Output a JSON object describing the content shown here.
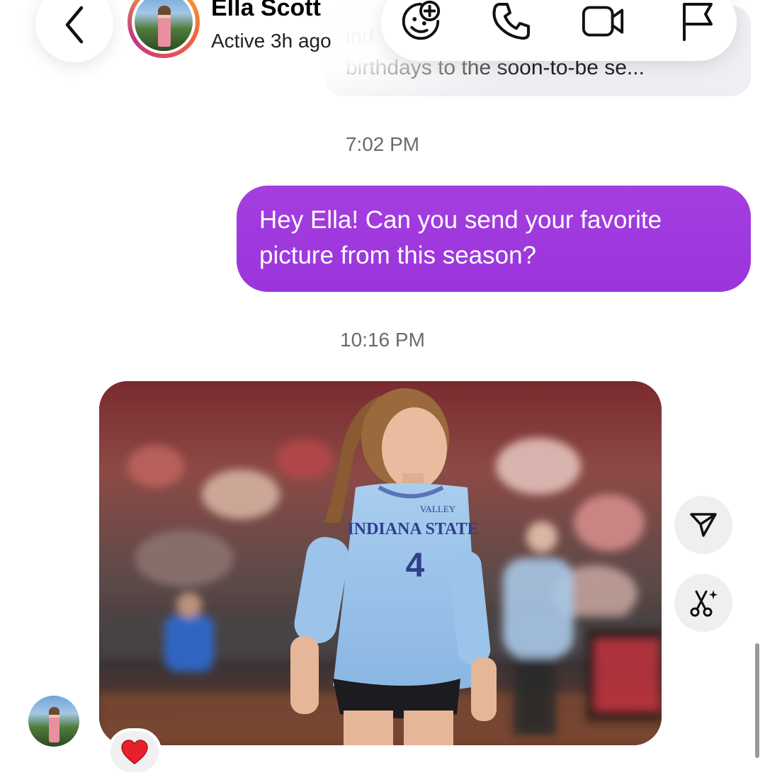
{
  "conversation": {
    "previous_message": {
      "line1_partial": "ind",
      "line2": "birthdays to the soon-to-be se..."
    },
    "messages": [
      {
        "timestamp": "7:02 PM"
      },
      {
        "timestamp": "10:16 PM"
      }
    ],
    "sent_message": {
      "text": "Hey Ella! Can you send your favorite picture from this season?",
      "bubble_color": "#9b36dc"
    },
    "photo": {
      "jersey_team_top": "VALLEY",
      "jersey_team": "INDIANA STATE",
      "jersey_number": "4"
    },
    "reaction": {
      "emoji": "❤️",
      "icon": "heart-icon"
    }
  },
  "header": {
    "contact_name": "Ella Scott",
    "contact_status": "Active 3h ago",
    "back_icon": "chevron-left-icon",
    "actions": [
      {
        "name": "add-sticker",
        "icon": "sticker-plus-icon"
      },
      {
        "name": "audio-call",
        "icon": "phone-icon"
      },
      {
        "name": "video-call",
        "icon": "video-camera-icon"
      },
      {
        "name": "report",
        "icon": "flag-icon"
      }
    ]
  },
  "photo_actions": [
    {
      "name": "share",
      "icon": "send-icon"
    },
    {
      "name": "remix",
      "icon": "scissors-sparkle-icon"
    }
  ]
}
